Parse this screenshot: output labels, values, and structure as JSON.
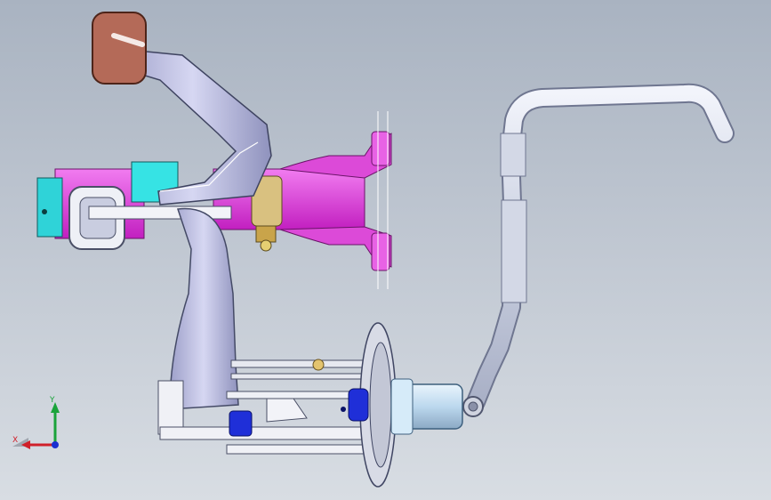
{
  "viewport": {
    "background_top": "#a9b3c1",
    "background_bottom": "#d8dde3"
  },
  "triad": {
    "x_label": "X",
    "y_label": "Y",
    "x_color": "#d0202a",
    "y_color": "#1aa33a",
    "z_color": "#1a2fd0"
  },
  "parts": [
    {
      "name": "pedal-pad",
      "color": "#b8705e"
    },
    {
      "name": "pedal-arm",
      "color": "#c8c9ec"
    },
    {
      "name": "bracket-magenta",
      "color": "#e33be0"
    },
    {
      "name": "bracket-cyan",
      "color": "#2fe0e0"
    },
    {
      "name": "pivot-bushing",
      "color": "#d7c07a"
    },
    {
      "name": "lower-arm",
      "color": "#bfc1e6"
    },
    {
      "name": "master-cylinder",
      "color": "#cfe6f5"
    },
    {
      "name": "hose-tube",
      "color": "#dfe4f2"
    },
    {
      "name": "blue-fitting",
      "color": "#1f2fd8"
    }
  ]
}
